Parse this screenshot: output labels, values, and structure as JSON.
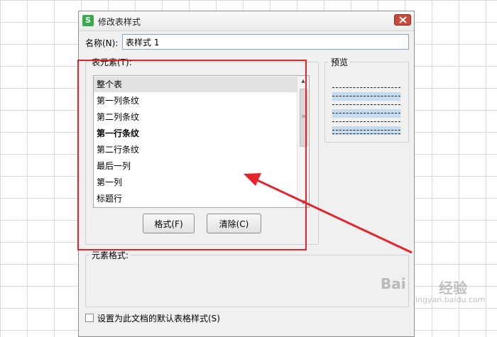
{
  "dialog": {
    "title": "修改表样式",
    "app_icon_letter": "S",
    "name_label": "名称(N):",
    "name_value": "表样式 1"
  },
  "elements_group": {
    "label": "表元素(T):",
    "items": [
      {
        "label": "整个表",
        "selected": true,
        "bold": false
      },
      {
        "label": "第一列条纹",
        "selected": false,
        "bold": false
      },
      {
        "label": "第二列条纹",
        "selected": false,
        "bold": false
      },
      {
        "label": "第一行条纹",
        "selected": false,
        "bold": true
      },
      {
        "label": "第二行条纹",
        "selected": false,
        "bold": false
      },
      {
        "label": "最后一列",
        "selected": false,
        "bold": false
      },
      {
        "label": "第一列",
        "selected": false,
        "bold": false
      },
      {
        "label": "标题行",
        "selected": false,
        "bold": false
      }
    ],
    "format_button": "格式(F)",
    "clear_button": "清除(C)"
  },
  "preview": {
    "label": "预览",
    "shade_color": "#c7dbee"
  },
  "element_format": {
    "label": "元素格式:"
  },
  "default_checkbox": {
    "label": "设置为此文档的默认表格样式(S)",
    "checked": false
  },
  "annotation": {
    "color": "#e5232a"
  },
  "watermark": {
    "text": "Bai",
    "cn": "经验",
    "sub": "jingyan.baidu.com"
  }
}
